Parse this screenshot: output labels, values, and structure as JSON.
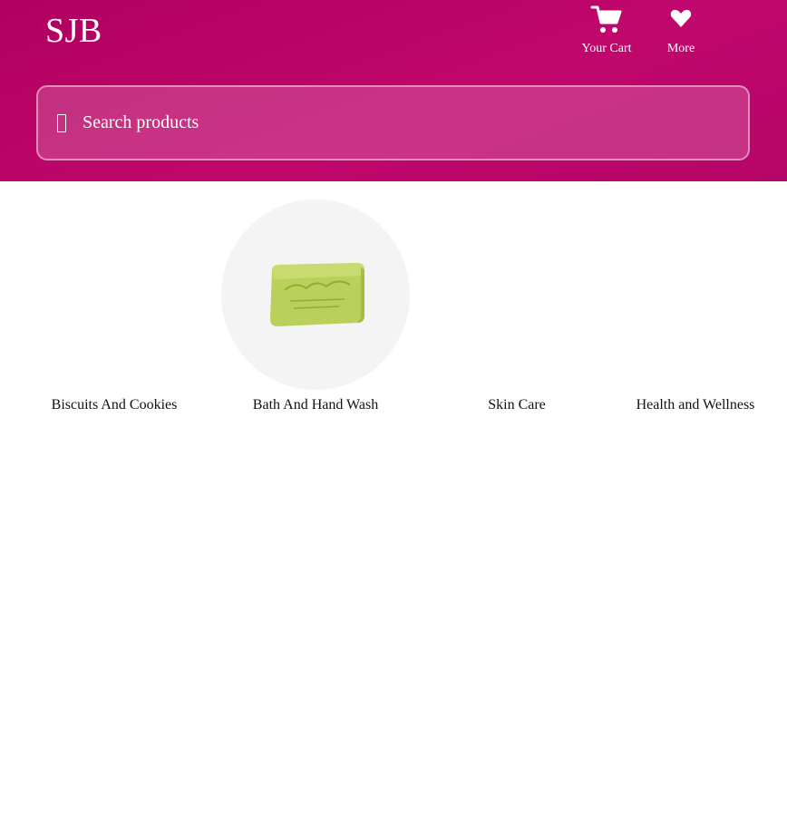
{
  "header": {
    "brand": "SJB",
    "nav": {
      "cart_label": "Your Cart",
      "more_label": "More",
      "cart_icon": "cart-icon",
      "more_icon": "heart-icon"
    },
    "search": {
      "placeholder": "Search products",
      "value": ""
    }
  },
  "categories": [
    {
      "label": "Biscuits And Cookies",
      "image": ""
    },
    {
      "label": "Bath And Hand Wash",
      "image": "green-soap-bar"
    },
    {
      "label": "Skin Care",
      "image": ""
    },
    {
      "label": "Health and Wellness",
      "image": ""
    }
  ],
  "colors": {
    "header_start": "#b0005f",
    "header_end": "#c0076c",
    "accent_text": "#ffffff"
  }
}
